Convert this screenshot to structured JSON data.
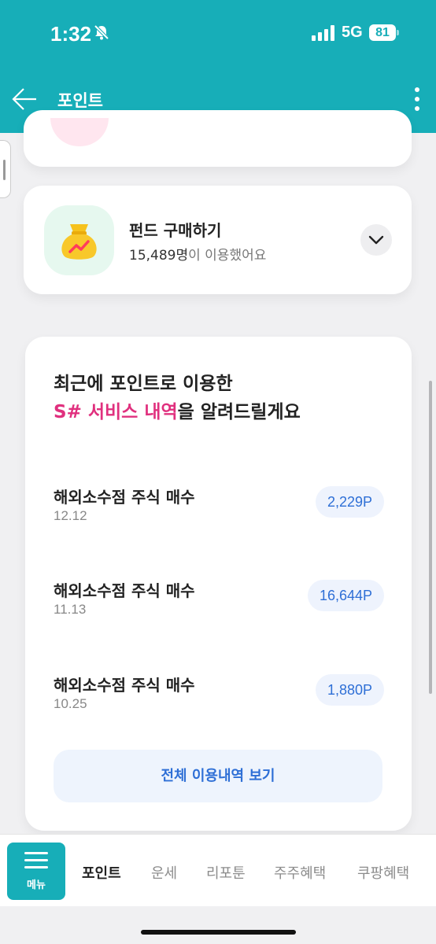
{
  "status_bar": {
    "time": "1:32",
    "network": "5G",
    "battery": "81"
  },
  "nav": {
    "title": "포인트"
  },
  "fund_card": {
    "title": "펀드 구매하기",
    "count": "15,489명",
    "count_suffix": "이 이용했어요"
  },
  "history": {
    "heading_line1": "최근에 포인트로 이용한",
    "heading_accent": "S# 서비스 내역",
    "heading_rest": "을 알려드릴게요",
    "items": [
      {
        "name": "해외소수점 주식 매수",
        "date": "12.12",
        "points": "2,229P"
      },
      {
        "name": "해외소수점 주식 매수",
        "date": "11.13",
        "points": "16,644P"
      },
      {
        "name": "해외소수점 주식 매수",
        "date": "10.25",
        "points": "1,880P"
      }
    ],
    "view_all_label": "전체 이용내역 보기"
  },
  "tabbar": {
    "menu_label": "메뉴",
    "tabs": [
      {
        "label": "포인트",
        "active": true
      },
      {
        "label": "운세",
        "active": false
      },
      {
        "label": "리포툰",
        "active": false
      },
      {
        "label": "주주혜택",
        "active": false
      },
      {
        "label": "쿠팡혜택",
        "active": false
      }
    ]
  },
  "colors": {
    "brand": "#17aeb8",
    "accent_pink": "#e0307e",
    "points_blue": "#2e6fd6"
  },
  "icons": [
    "back-arrow-icon",
    "more-vertical-icon",
    "money-bag-icon",
    "chevron-down-icon",
    "hamburger-menu-icon",
    "bell-muted-icon",
    "signal-icon",
    "battery-icon"
  ]
}
